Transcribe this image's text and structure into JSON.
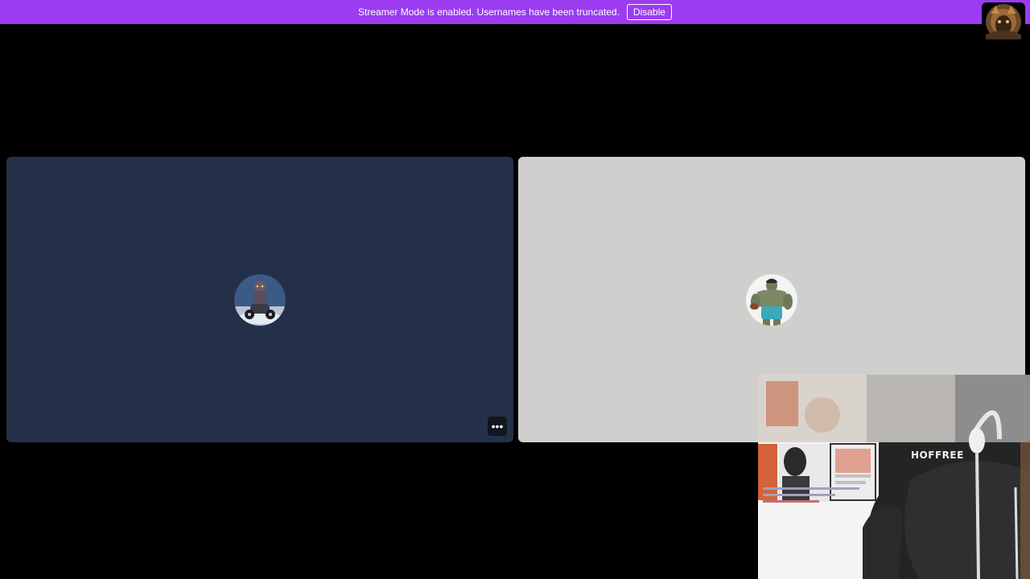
{
  "banner": {
    "message": "Streamer Mode is enabled. Usernames have been truncated.",
    "disable_label": "Disable",
    "color": "#9b3cf0"
  },
  "participants": [
    {
      "avatar_icon": "robot-figure-avatar-icon",
      "tile_color": "#24304a"
    },
    {
      "avatar_icon": "hulk-avatar-icon",
      "tile_color": "#cfd0ce"
    }
  ],
  "tile_more_label": "•••",
  "webcam": {
    "overlay_text": "HOFFREE"
  }
}
